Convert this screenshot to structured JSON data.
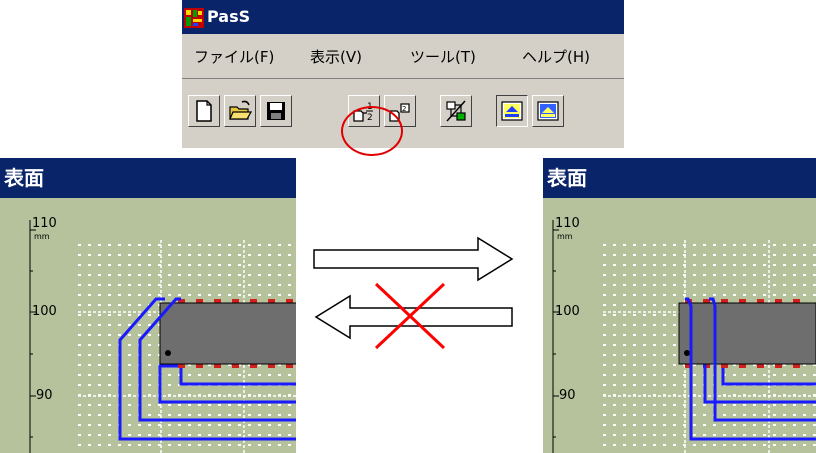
{
  "app": {
    "title": "PasS",
    "menu": [
      "ファイル(F)",
      "表示(V)",
      "ツール(T)",
      "ヘルプ(H)"
    ],
    "toolbar_icons": [
      "new-file-icon",
      "open-folder-icon",
      "save-disk-icon",
      "flip-side-icon",
      "side-alt-icon",
      "network-icon",
      "view-top-icon",
      "view-bottom-icon"
    ]
  },
  "panels": {
    "left": {
      "title": "表面",
      "ticks": [
        "110",
        "100",
        "90"
      ],
      "unit": "mm"
    },
    "right": {
      "title": "表面",
      "ticks": [
        "110",
        "100",
        "90"
      ],
      "unit": "mm"
    }
  },
  "colors": {
    "titlebar": "#0a246a",
    "board": "#b5c29c",
    "trace": "#1a1aff",
    "chip": "#6e6e6e",
    "pin": "#d02020",
    "cross": "#ff0000"
  }
}
